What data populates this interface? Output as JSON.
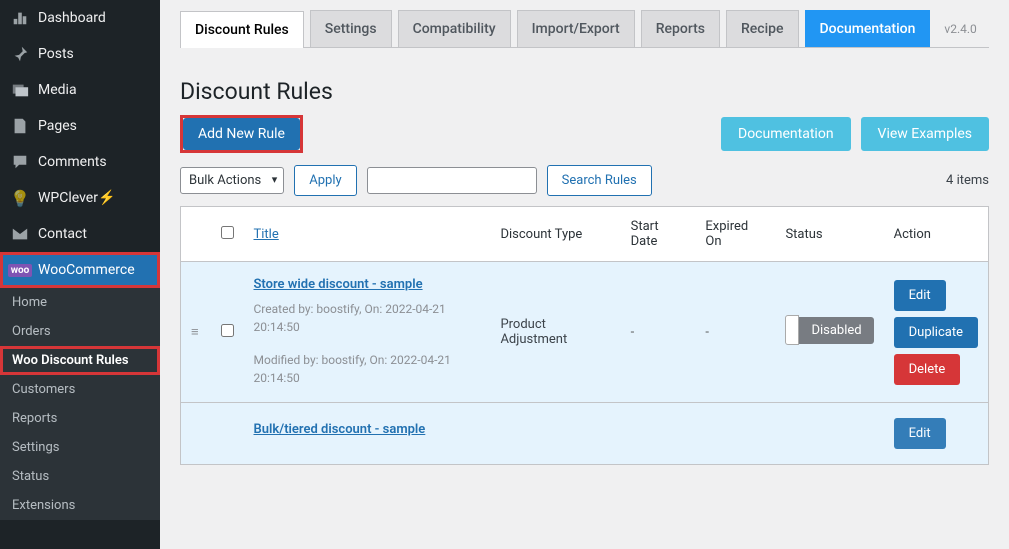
{
  "sidebar": {
    "dashboard": "Dashboard",
    "posts": "Posts",
    "media": "Media",
    "pages": "Pages",
    "comments": "Comments",
    "wpclever": "WPClever",
    "contact": "Contact",
    "woocommerce": "WooCommerce",
    "sub": {
      "home": "Home",
      "orders": "Orders",
      "wdr": "Woo Discount Rules",
      "customers": "Customers",
      "reports": "Reports",
      "settings": "Settings",
      "status": "Status",
      "extensions": "Extensions"
    }
  },
  "tabs": {
    "discount_rules": "Discount Rules",
    "settings": "Settings",
    "compatibility": "Compatibility",
    "import_export": "Import/Export",
    "reports": "Reports",
    "recipe": "Recipe",
    "documentation": "Documentation"
  },
  "version": "v2.4.0",
  "page_title": "Discount Rules",
  "buttons": {
    "add_rule": "Add New Rule",
    "documentation": "Documentation",
    "view_examples": "View Examples",
    "apply": "Apply",
    "search": "Search Rules",
    "edit": "Edit",
    "duplicate": "Duplicate",
    "delete": "Delete"
  },
  "bulk_label": "Bulk Actions",
  "items_count": "4 items",
  "columns": {
    "title": "Title",
    "discount_type": "Discount Type",
    "start": "Start Date",
    "expired": "Expired On",
    "status": "Status",
    "action": "Action"
  },
  "rules": [
    {
      "title": "Store wide discount - sample",
      "created": "Created by: boostify, On: 2022-04-21 20:14:50",
      "modified": "Modified by: boostify, On: 2022-04-21 20:14:50",
      "discount_type": "Product Adjustment",
      "start": "-",
      "expired": "-",
      "status": "Disabled"
    },
    {
      "title": "Bulk/tiered discount - sample"
    }
  ]
}
